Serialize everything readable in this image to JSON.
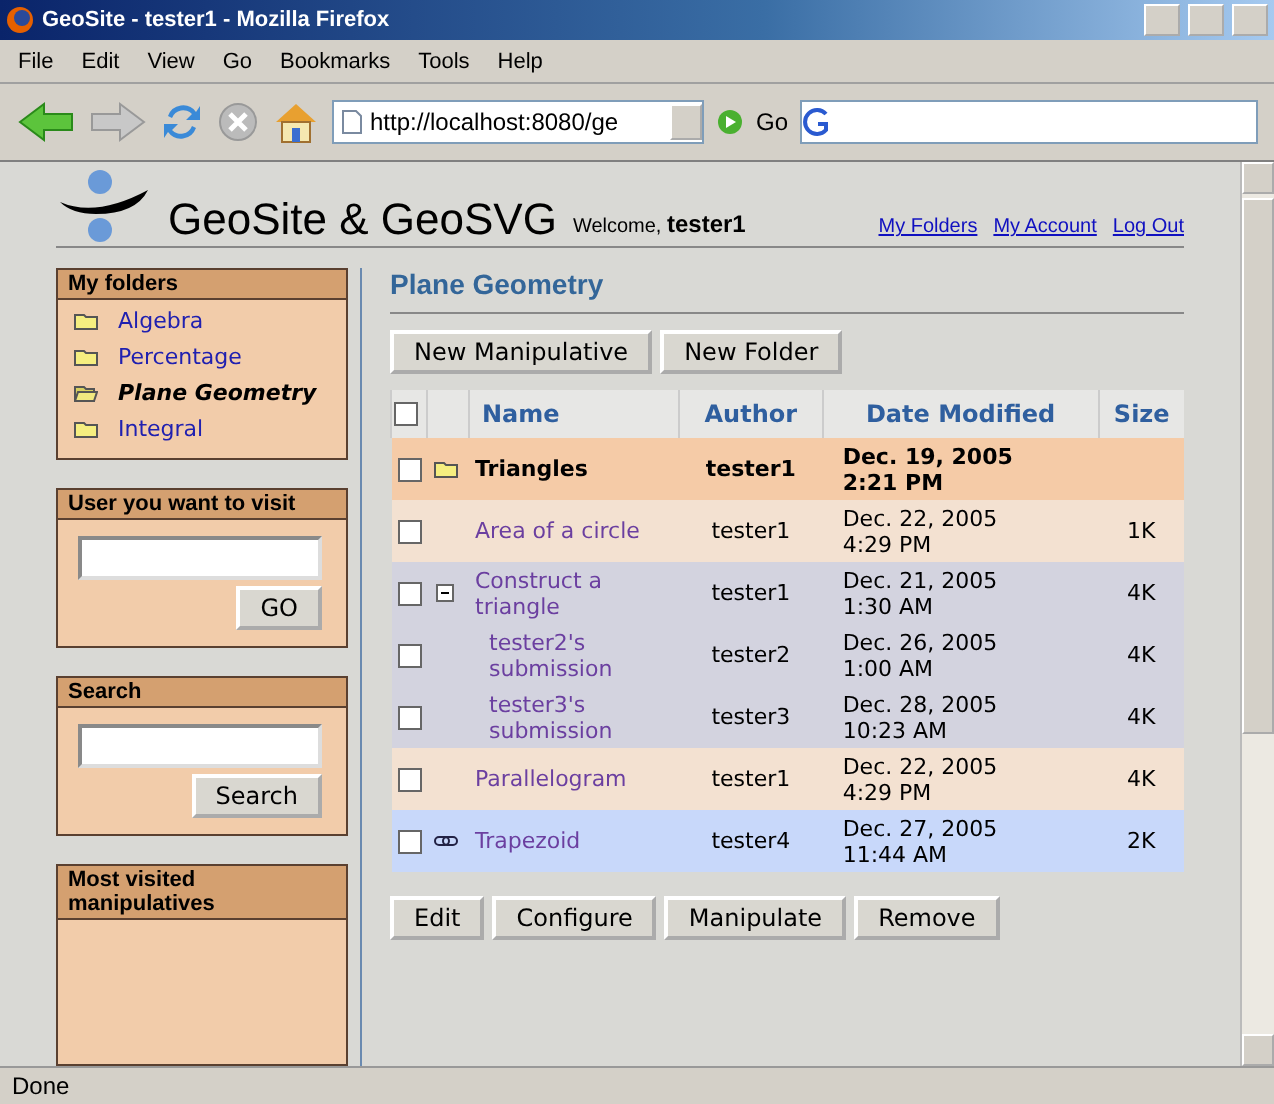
{
  "window": {
    "title": "GeoSite - tester1 - Mozilla Firefox"
  },
  "menu": [
    "File",
    "Edit",
    "View",
    "Go",
    "Bookmarks",
    "Tools",
    "Help"
  ],
  "toolbar": {
    "url": "http://localhost:8080/ge",
    "go": "Go"
  },
  "header": {
    "site": "GeoSite & GeoSVG",
    "welcome": "Welcome,",
    "user": "tester1",
    "links": [
      "My Folders",
      "My Account",
      "Log Out"
    ]
  },
  "sidebar": {
    "folders_title": "My folders",
    "folders": [
      {
        "label": "Algebra",
        "selected": false
      },
      {
        "label": "Percentage",
        "selected": false
      },
      {
        "label": "Plane Geometry",
        "selected": true
      },
      {
        "label": "Integral",
        "selected": false
      }
    ],
    "visit": {
      "title": "User you want to visit",
      "button": "GO"
    },
    "search": {
      "title": "Search",
      "button": "Search"
    },
    "most_visited": {
      "title": "Most visited manipulatives"
    }
  },
  "main": {
    "title": "Plane Geometry",
    "top_buttons": [
      "New Manipulative",
      "New Folder"
    ],
    "select_all_checked": false,
    "columns": [
      "Name",
      "Author",
      "Date Modified",
      "Size"
    ],
    "rows": [
      {
        "kind": "folder",
        "checked": false,
        "name": "Triangles",
        "author": "tester1",
        "date": "Dec. 19, 2005",
        "time": "2:21 PM"
      },
      {
        "kind": "manipulative",
        "checked": false,
        "name": "Area of a circle",
        "author": "tester1",
        "date": "Dec. 22, 2005",
        "time": "4:29 PM",
        "size": "1K"
      },
      {
        "kind": "group",
        "checked": false,
        "expanded": true,
        "name": "Construct a triangle",
        "author": "tester1",
        "date": "Dec. 21, 2005",
        "time": "1:30 AM",
        "size": "4K",
        "children": [
          {
            "kind": "submission",
            "checked": false,
            "name": "tester2's submission",
            "author": "tester2",
            "date": "Dec. 26, 2005",
            "time": "1:00 AM",
            "size": "4K"
          },
          {
            "kind": "submission",
            "checked": false,
            "name": "tester3's submission",
            "author": "tester3",
            "date": "Dec. 28, 2005",
            "time": "10:23 AM",
            "size": "4K"
          }
        ]
      },
      {
        "kind": "manipulative",
        "checked": false,
        "name": "Parallelogram",
        "author": "tester1",
        "date": "Dec. 22, 2005",
        "time": "4:29 PM",
        "size": "4K"
      },
      {
        "kind": "link",
        "checked": false,
        "name": "Trapezoid",
        "author": "tester4",
        "date": "Dec. 27, 2005",
        "time": "11:44 AM",
        "size": "2K"
      }
    ],
    "bottom_buttons": [
      "Edit",
      "Configure",
      "Manipulate",
      "Remove"
    ]
  },
  "status_bar": "Done"
}
